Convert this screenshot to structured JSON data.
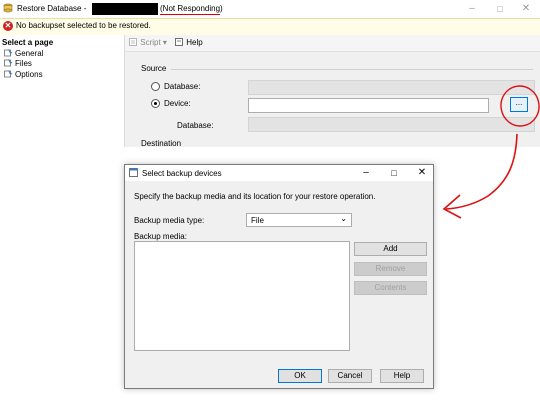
{
  "main_window": {
    "title_prefix": "Restore Database - ",
    "not_responding": "(Not Responding)",
    "error_message": "No backupset selected to be restored.",
    "toolbar": {
      "script_label": "Script",
      "help_label": "Help"
    },
    "left_pane": {
      "header": "Select a page",
      "pages": [
        {
          "label": "General"
        },
        {
          "label": "Files"
        },
        {
          "label": "Options"
        }
      ]
    },
    "source": {
      "section_label": "Source",
      "database_label": "Database:",
      "device_label": "Device:",
      "database_sub_label": "Database:",
      "browse_label": "...",
      "selected_option": "Device"
    },
    "destination_label": "Destination"
  },
  "dialog": {
    "title": "Select backup devices",
    "description": "Specify the backup media and its location for your restore operation.",
    "media_type_label": "Backup media type:",
    "media_type_value": "File",
    "media_label": "Backup media:",
    "buttons": {
      "add": "Add",
      "remove": "Remove",
      "contents": "Contents",
      "ok": "OK",
      "cancel": "Cancel",
      "help": "Help"
    }
  },
  "colors": {
    "annotation_red": "#dd1111",
    "error_bar_bg": "#fffde7",
    "accent_blue": "#0078d7"
  }
}
